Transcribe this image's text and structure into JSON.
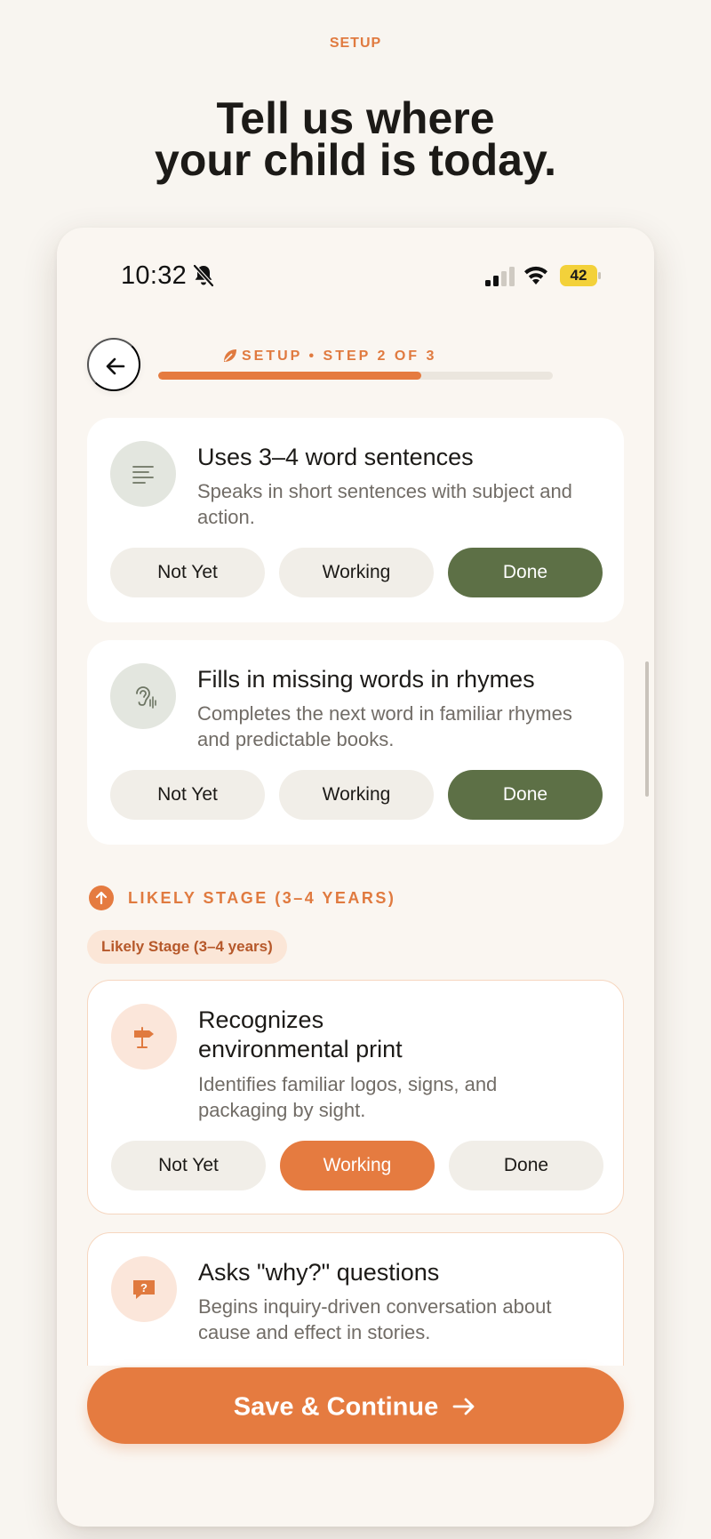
{
  "page": {
    "eyebrow": "SETUP",
    "headline_line1": "Tell us where",
    "headline_line2": "your child is today."
  },
  "status_bar": {
    "time": "10:32",
    "battery": "42"
  },
  "header": {
    "step_label": "SETUP • STEP 2 OF 3",
    "progress_fraction": 0.667
  },
  "milestones": [
    {
      "title": "Uses 3–4 word sentences",
      "description": "Speaks in short sentences with subject and action.",
      "icon": "text-lines-icon",
      "options": [
        "Not Yet",
        "Working",
        "Done"
      ],
      "selected": "Done"
    },
    {
      "title": "Fills in missing words in rhymes",
      "description": "Completes the next word in familiar rhymes and predictable books.",
      "icon": "ear-sound-icon",
      "options": [
        "Not Yet",
        "Working",
        "Done"
      ],
      "selected": "Done"
    }
  ],
  "stage": {
    "heading": "LIKELY STAGE (3–4 YEARS)",
    "chip": "Likely Stage (3–4 years)"
  },
  "stage_milestones": [
    {
      "title": "Recognizes environmental print",
      "description": "Identifies familiar logos, signs, and packaging by sight.",
      "icon": "signpost-icon",
      "options": [
        "Not Yet",
        "Working",
        "Done"
      ],
      "selected": "Working"
    },
    {
      "title": "Asks \"why?\" questions",
      "description": "Begins inquiry-driven conversation about cause and effect in stories.",
      "icon": "question-bubble-icon"
    }
  ],
  "footer": {
    "save_label": "Save & Continue"
  },
  "colors": {
    "accent": "#e57b40",
    "done": "#5d7046",
    "background": "#faf6f1"
  }
}
